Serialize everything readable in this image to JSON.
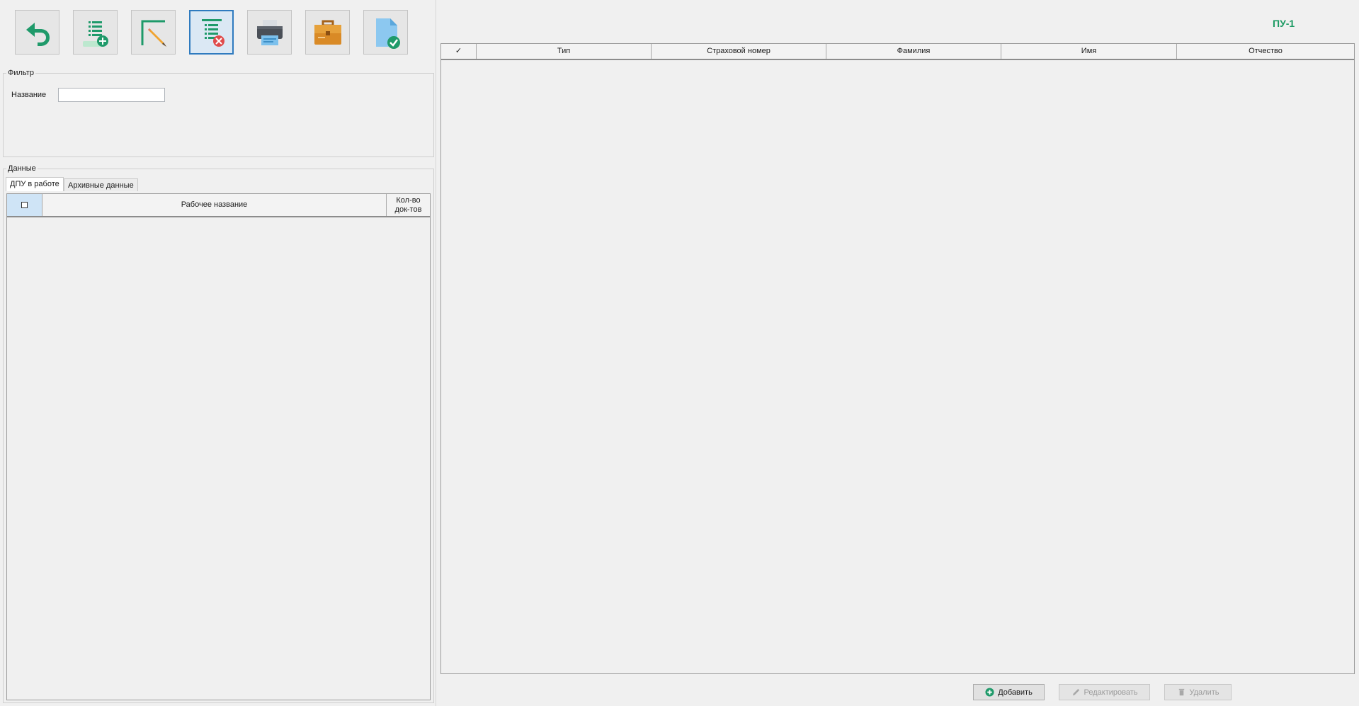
{
  "toolbar": {
    "buttons": [
      {
        "name": "back-button",
        "icon": "undo-arrow-icon"
      },
      {
        "name": "add-document-button",
        "icon": "list-add-icon"
      },
      {
        "name": "edit-button",
        "icon": "pencil-icon"
      },
      {
        "name": "delete-document-button",
        "icon": "list-delete-icon",
        "active": true
      },
      {
        "name": "print-button",
        "icon": "printer-icon"
      },
      {
        "name": "archive-button",
        "icon": "briefcase-icon"
      },
      {
        "name": "check-document-button",
        "icon": "document-check-icon"
      }
    ]
  },
  "filter": {
    "title": "Фильтр",
    "name_label": "Название",
    "name_value": ""
  },
  "data_section": {
    "title": "Данные",
    "tabs": [
      {
        "label": "ДПУ в работе",
        "selected": true
      },
      {
        "label": "Архивные данные",
        "selected": false
      }
    ],
    "grid": {
      "columns": [
        "",
        "Рабочее название",
        "Кол-во\nдок-тов"
      ],
      "rows": []
    }
  },
  "right": {
    "title": "ПУ-1",
    "grid": {
      "columns": [
        "✓",
        "Тип",
        "Страховой номер",
        "Фамилия",
        "Имя",
        "Отчество"
      ],
      "rows": []
    },
    "buttons": {
      "add": "Добавить",
      "edit": "Редактировать",
      "delete": "Удалить"
    }
  },
  "colors": {
    "accent_green": "#1c9a63",
    "active_border": "#2f7bbf",
    "background": "#f0f0f0"
  }
}
